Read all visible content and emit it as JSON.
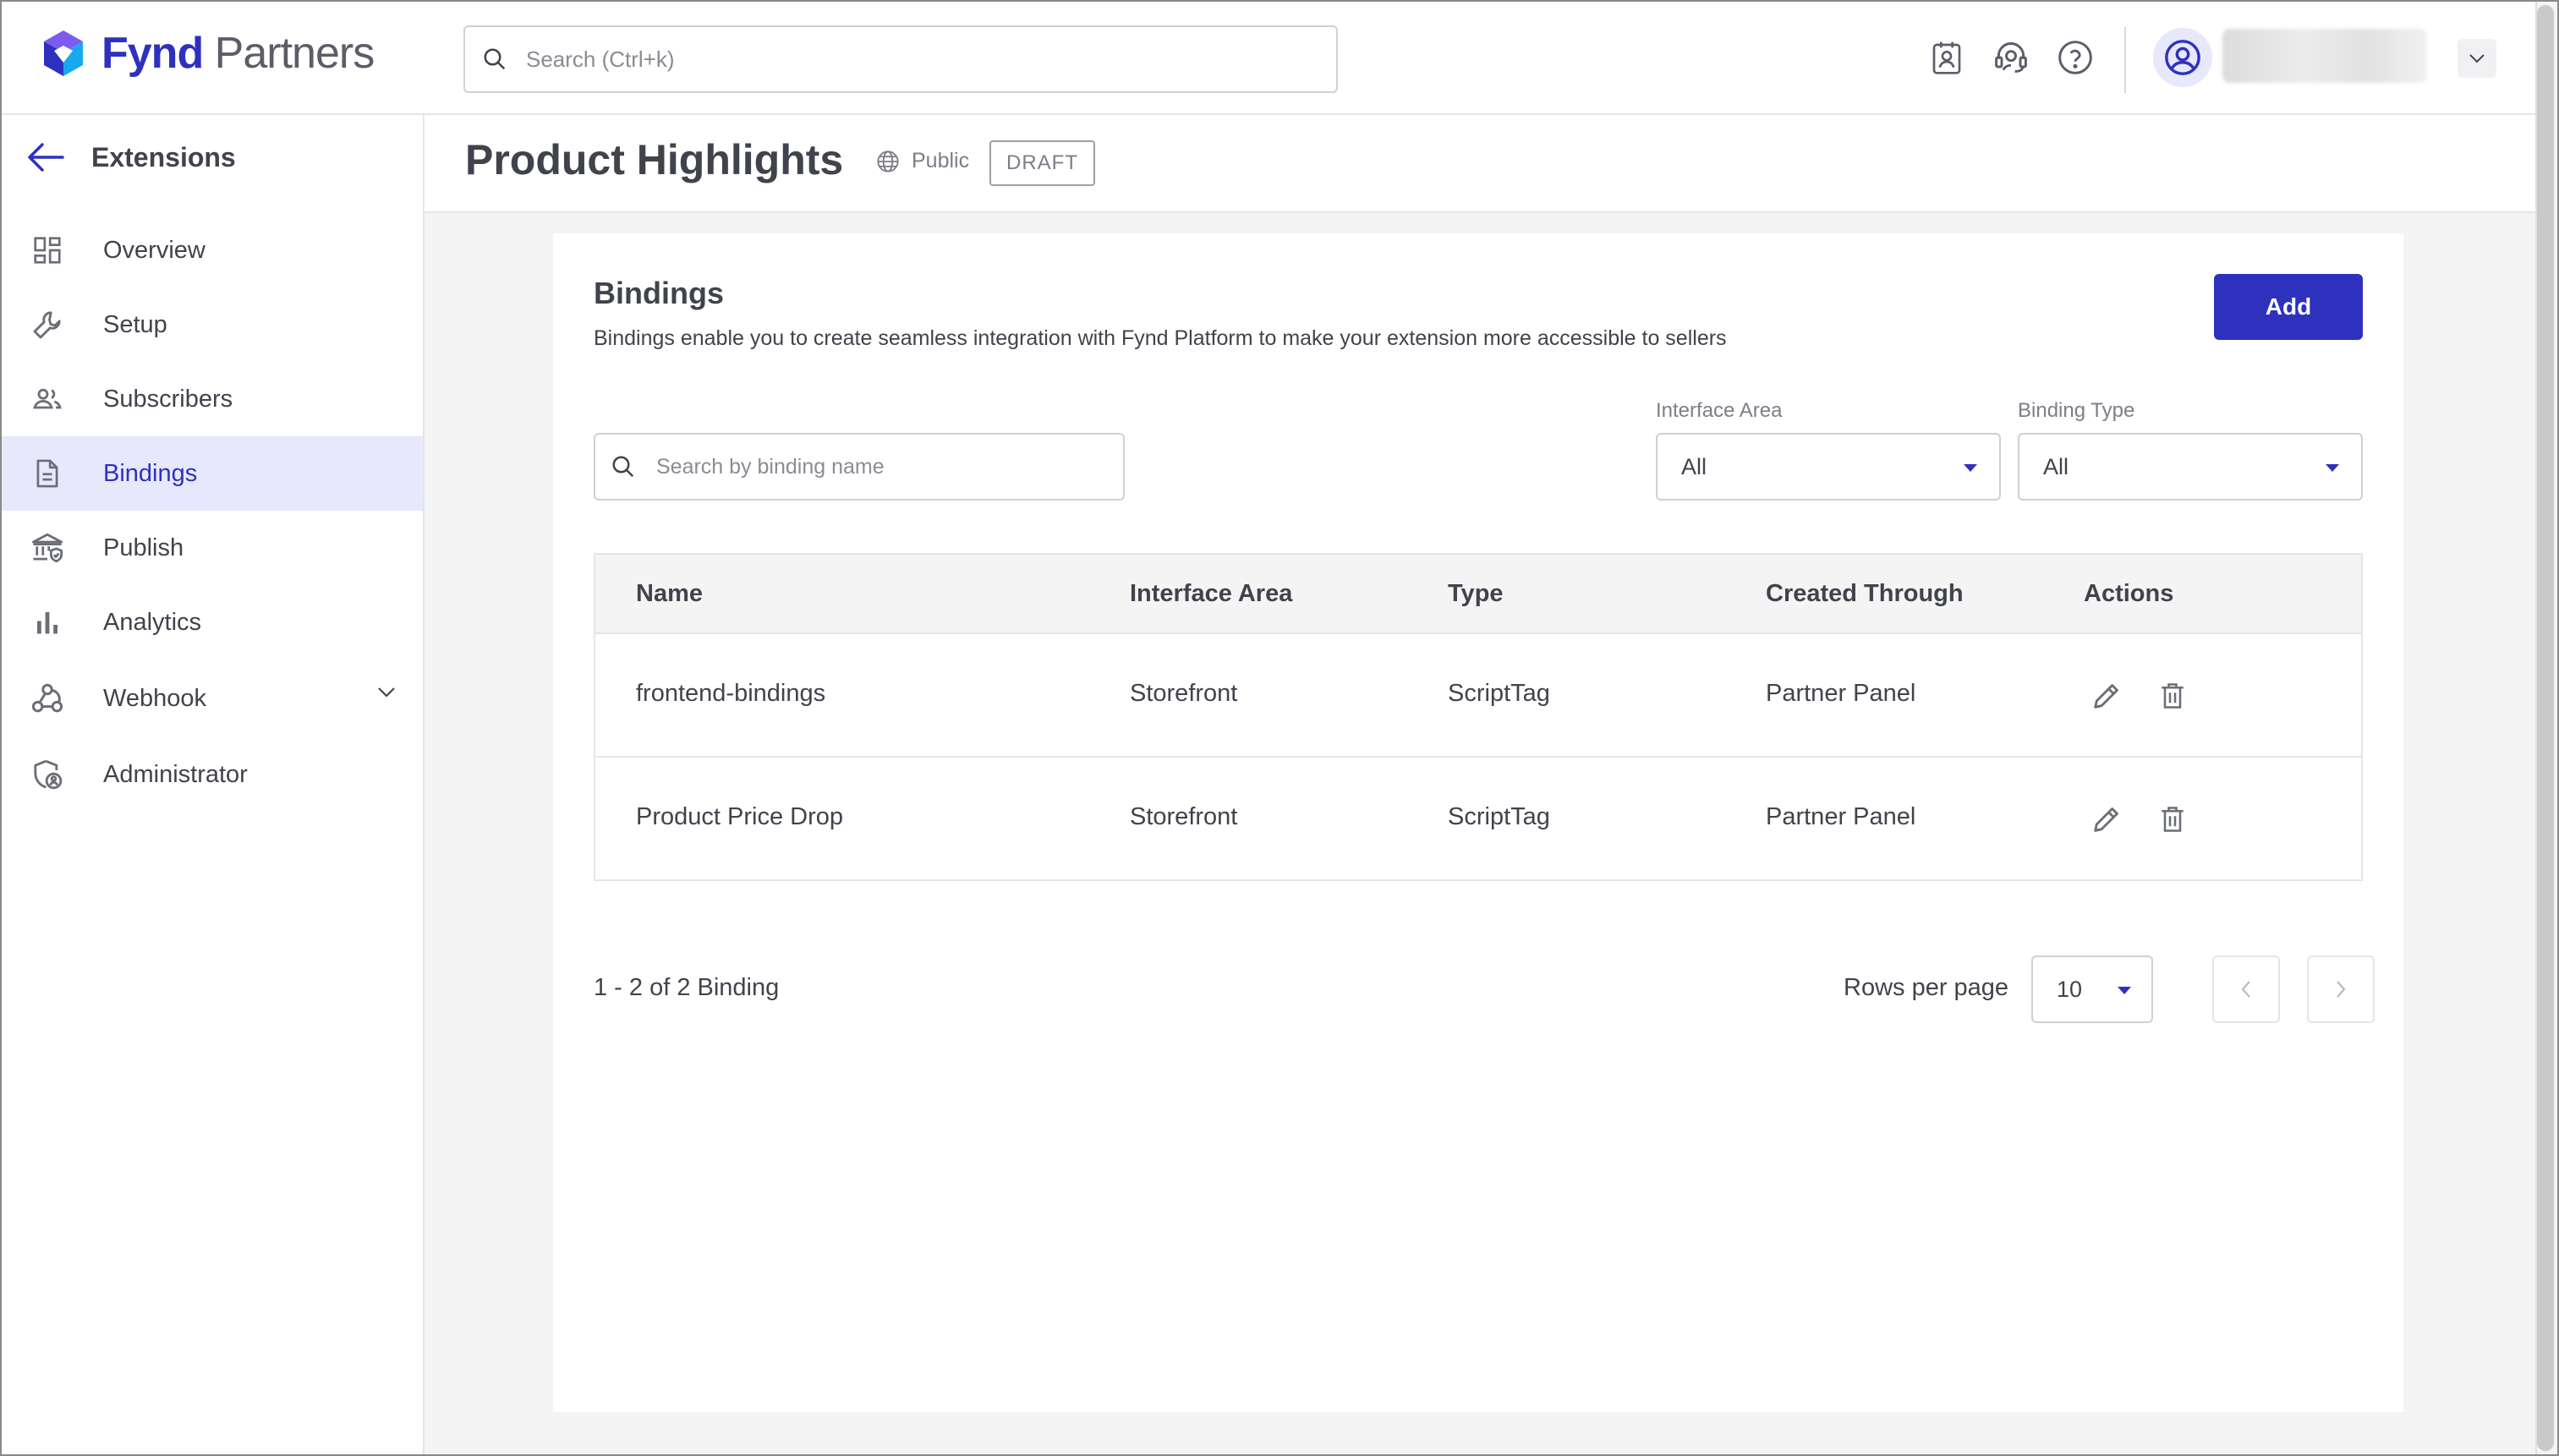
{
  "app": {
    "brand_primary": "Fynd",
    "brand_secondary": "Partners",
    "accent_color": "#2e31be"
  },
  "header": {
    "search_placeholder": "Search (Ctrl+k)",
    "icons": [
      "contact-card-icon",
      "support-headset-icon",
      "help-icon",
      "user-avatar-icon",
      "chevron-down-icon"
    ]
  },
  "sidebar": {
    "back_label": "Extensions",
    "items": [
      {
        "label": "Overview",
        "icon": "dashboard-grid-icon"
      },
      {
        "label": "Setup",
        "icon": "wrench-icon"
      },
      {
        "label": "Subscribers",
        "icon": "users-icon"
      },
      {
        "label": "Bindings",
        "icon": "document-icon",
        "active": true
      },
      {
        "label": "Publish",
        "icon": "bank-shield-icon"
      },
      {
        "label": "Analytics",
        "icon": "bar-chart-icon"
      },
      {
        "label": "Webhook",
        "icon": "webhook-icon",
        "expandable": true
      },
      {
        "label": "Administrator",
        "icon": "admin-shield-icon"
      }
    ]
  },
  "page": {
    "title": "Product Highlights",
    "visibility": "Public",
    "status": "DRAFT"
  },
  "bindings": {
    "title": "Bindings",
    "description": "Bindings enable you to create seamless integration with Fynd Platform to make your extension more accessible to sellers",
    "add_label": "Add",
    "search_placeholder": "Search by binding name",
    "filters": {
      "interface_area": {
        "label": "Interface Area",
        "value": "All"
      },
      "binding_type": {
        "label": "Binding Type",
        "value": "All"
      }
    },
    "table": {
      "headers": [
        "Name",
        "Interface Area",
        "Type",
        "Created Through",
        "Actions"
      ],
      "rows": [
        {
          "name": "frontend-bindings",
          "interface_area": "Storefront",
          "type": "ScriptTag",
          "created_through": "Partner Panel"
        },
        {
          "name": "Product Price Drop",
          "interface_area": "Storefront",
          "type": "ScriptTag",
          "created_through": "Partner Panel"
        }
      ]
    },
    "pagination": {
      "summary": "1 - 2 of 2 Binding",
      "rows_per_page_label": "Rows per page",
      "rows_per_page": "10"
    }
  }
}
